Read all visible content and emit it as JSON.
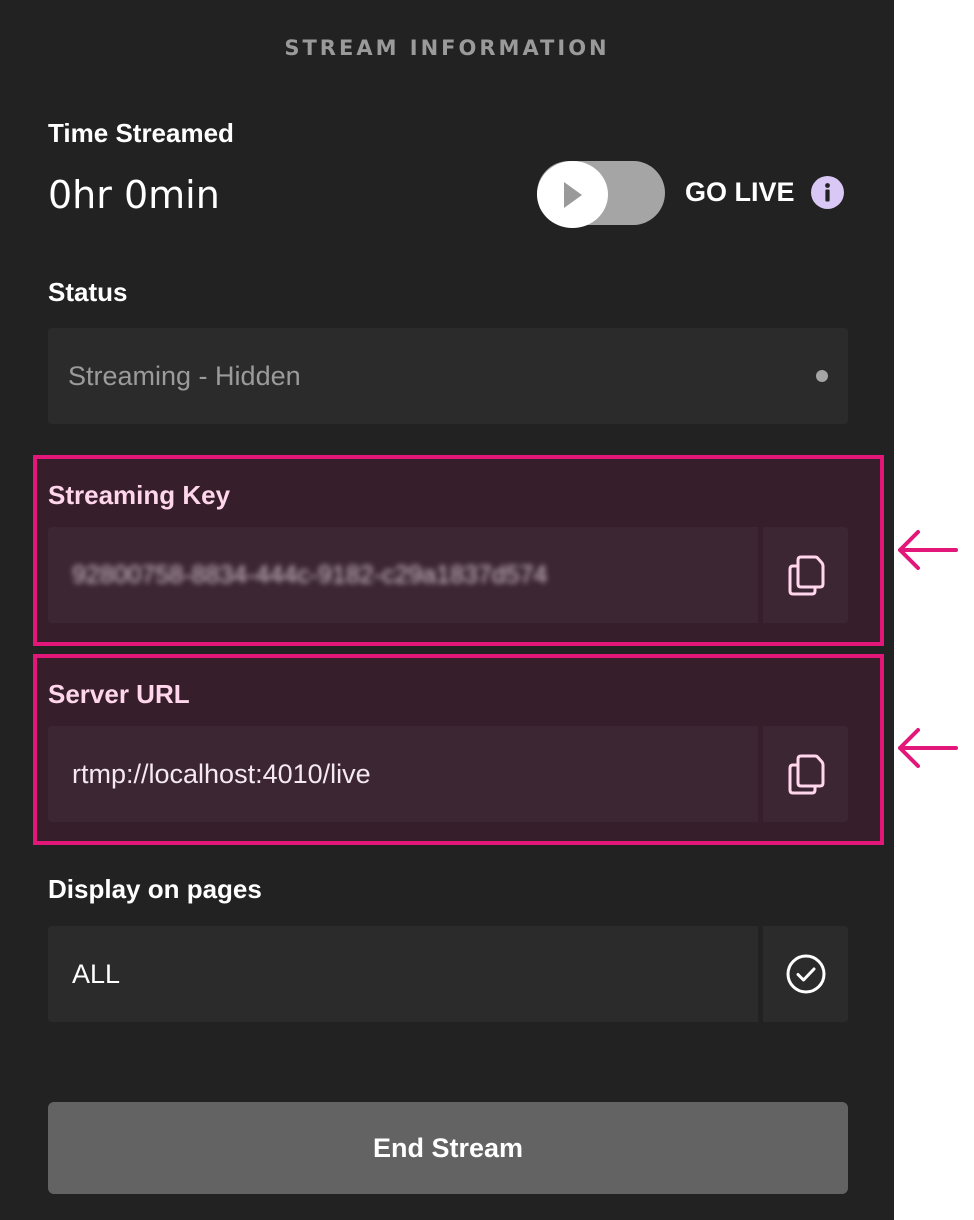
{
  "header": {
    "title": "STREAM INFORMATION"
  },
  "time_streamed": {
    "label": "Time Streamed",
    "value": "0hr 0min"
  },
  "go_live": {
    "label": "GO LIVE",
    "toggle_state": "off",
    "toggle_icon": "play-icon",
    "info_icon": "info-icon"
  },
  "status": {
    "label": "Status",
    "value": "Streaming - Hidden",
    "indicator_color": "#a5a5a5"
  },
  "streaming_key": {
    "label": "Streaming Key",
    "value": "92800758-8834-444c-9182-c29a1837d574",
    "obscured": true,
    "copy_icon": "copy-icon"
  },
  "server_url": {
    "label": "Server URL",
    "value": "rtmp://localhost:4010/live",
    "copy_icon": "copy-icon"
  },
  "display_on_pages": {
    "label": "Display on pages",
    "value": "ALL",
    "confirm_icon": "check-circle-icon"
  },
  "end_stream": {
    "label": "End Stream"
  },
  "annotations": {
    "highlight_color": "#e3177a",
    "arrow_icon": "arrow-left-icon"
  },
  "colors": {
    "panel_bg": "#222222",
    "field_bg": "#2b2b2b",
    "highlight_bg": "#361e2b",
    "button_bg": "#636363",
    "info_icon": "#d9c8f5"
  }
}
